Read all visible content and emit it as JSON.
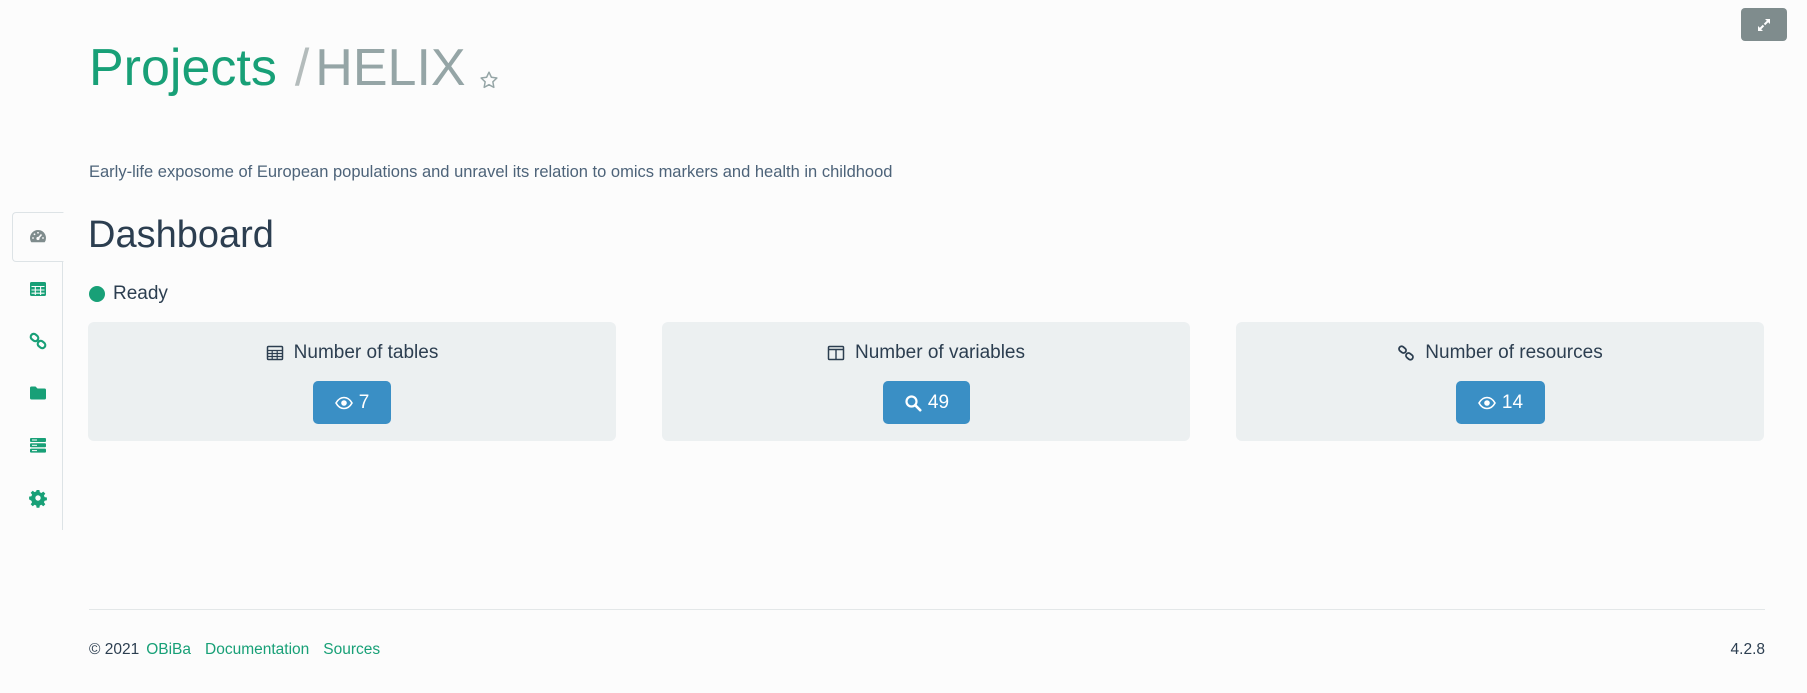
{
  "header": {
    "title": "Projects",
    "separator": "/",
    "project_name": "HELIX",
    "star_icon": "star-outline-icon",
    "expand_icon": "expand-arrows-icon"
  },
  "description": "Early-life exposome of European populations and unravel its relation to omics markers and health in childhood",
  "sidebar": {
    "items": [
      {
        "icon": "dashboard-icon",
        "active": true
      },
      {
        "icon": "table-icon"
      },
      {
        "icon": "link-icon"
      },
      {
        "icon": "folder-icon"
      },
      {
        "icon": "server-icon"
      },
      {
        "icon": "gear-icon"
      }
    ]
  },
  "dashboard": {
    "title": "Dashboard",
    "status": "Ready",
    "status_color": "#18a077",
    "cards": [
      {
        "label": "Number of tables",
        "icon": "table-icon",
        "button_icon": "eye-icon",
        "count": "7"
      },
      {
        "label": "Number of variables",
        "icon": "columns-icon",
        "button_icon": "search-icon",
        "count": "49"
      },
      {
        "label": "Number of resources",
        "icon": "link-icon",
        "button_icon": "eye-icon",
        "count": "14"
      }
    ]
  },
  "footer": {
    "copyright": "© 2021",
    "links": [
      "OBiBa",
      "Documentation",
      "Sources"
    ],
    "version": "4.2.8"
  },
  "colors": {
    "accent": "#18a077",
    "button": "#3a8fc5",
    "card_bg": "#ecf0f1",
    "muted": "#95a5a6"
  }
}
